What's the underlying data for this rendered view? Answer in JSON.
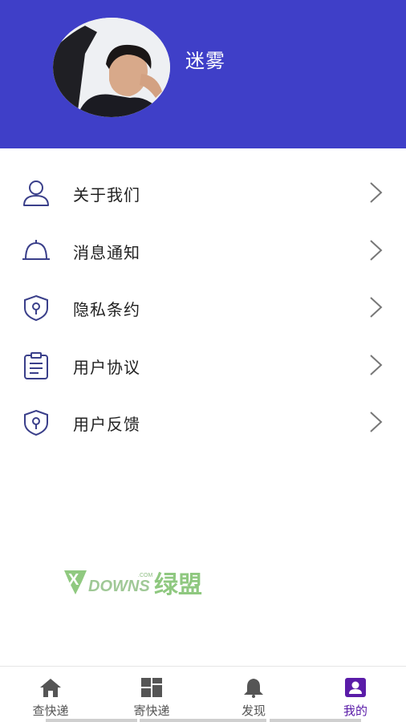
{
  "profile": {
    "username": "迷雾"
  },
  "menu": [
    {
      "label": "关于我们",
      "icon": "user-icon"
    },
    {
      "label": "消息通知",
      "icon": "bell-icon"
    },
    {
      "label": "隐私条约",
      "icon": "shield-icon"
    },
    {
      "label": "用户协议",
      "icon": "clipboard-icon"
    },
    {
      "label": "用户反馈",
      "icon": "shield-icon"
    }
  ],
  "watermark": {
    "brand": "DOWNS",
    "prefix": "X",
    "suffix": "绿盟",
    "domain": ".COM"
  },
  "tabbar": [
    {
      "label": "查快递",
      "icon": "home-icon",
      "active": false
    },
    {
      "label": "寄快递",
      "icon": "grid-icon",
      "active": false
    },
    {
      "label": "发现",
      "icon": "bell-icon",
      "active": false
    },
    {
      "label": "我的",
      "icon": "profile-icon",
      "active": true
    }
  ],
  "colors": {
    "header_bg": "#3f3fc8",
    "icon_stroke": "#3a3f8a",
    "active_tab": "#5a1ca8",
    "inactive_tab": "#555555"
  }
}
